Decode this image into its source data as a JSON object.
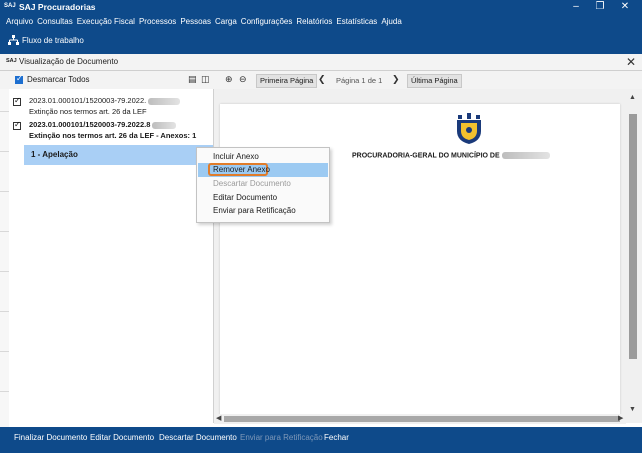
{
  "window": {
    "logo": "SAJ",
    "title": "SAJ Procuradorias",
    "controls": [
      "minimize-icon",
      "maximize-icon",
      "close-icon"
    ]
  },
  "menu": [
    "Arquivo",
    "Consultas",
    "Execução Fiscal",
    "Processos",
    "Pessoas",
    "Carga",
    "Configurações",
    "Relatórios",
    "Estatísticas",
    "Ajuda"
  ],
  "toolbar": {
    "workflow_label": "Fluxo de trabalho",
    "workflow_icon": "flowchart-icon"
  },
  "doc_window": {
    "logo": "SAJ",
    "title": "Visualização de Documento",
    "close_icon": "close-icon"
  },
  "doc_toolbar": {
    "uncheck_all_label": "Desmarcar Todos",
    "uncheck_all_checked": true,
    "first_page_label": "Primeira Página",
    "page_indicator": "Página 1 de 1",
    "last_page_label": "Última Página"
  },
  "documents": [
    {
      "title": "2023.01.000101/1520003-79.2022.",
      "subtitle": "Extinção nos termos art. 26 da LEF",
      "checked": true
    },
    {
      "title": "2023.01.000101/1520003-79.2022.8",
      "subtitle": "Extinção nos termos art. 26 da LEF - Anexos: 1",
      "checked": true
    }
  ],
  "attachment": {
    "label": "1 - Apelação"
  },
  "context_menu": [
    {
      "label": "Incluir Anexo",
      "enabled": true
    },
    {
      "label": "Remover Anexo",
      "enabled": true,
      "highlighted": true
    },
    {
      "label": "Descartar Documento",
      "enabled": false
    },
    {
      "label": "Editar Documento",
      "enabled": true
    },
    {
      "label": "Enviar para Retificação",
      "enabled": true
    }
  ],
  "preview": {
    "header": "PROCURADORIA-GERAL DO MUNICÍPIO DE",
    "crest_icon": "municipal-crest-icon"
  },
  "bottom_bar": [
    {
      "label": "Finalizar Documento",
      "enabled": true
    },
    {
      "label": "Editar Documento",
      "enabled": true
    },
    {
      "label": "Descartar Documento",
      "enabled": true
    },
    {
      "label": "Enviar para Retificação",
      "enabled": false
    },
    {
      "label": "Fechar",
      "enabled": true
    }
  ],
  "colors": {
    "app_blue": "#0e4a8a",
    "selection": "#a9cff5",
    "highlight_outline": "#e07c2a"
  }
}
